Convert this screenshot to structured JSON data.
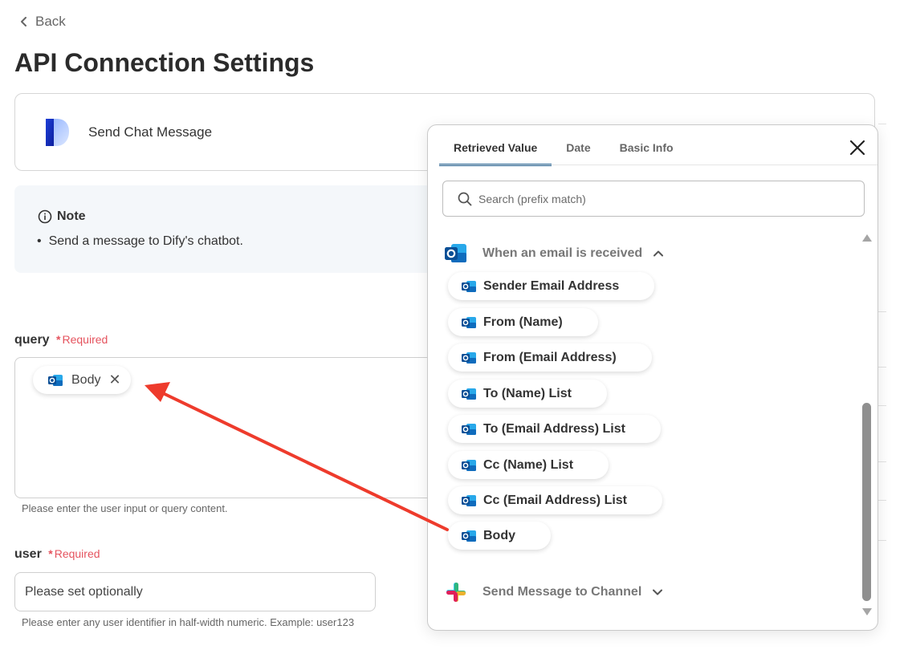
{
  "nav": {
    "back_label": "Back"
  },
  "page": {
    "title": "API Connection Settings"
  },
  "app_card": {
    "name": "Send Chat Message"
  },
  "note": {
    "title": "Note",
    "text": "Send a message to Dify's chatbot."
  },
  "fields": {
    "query": {
      "label": "query",
      "required_label": "Required",
      "chip_label": "Body",
      "help": "Please enter the user input or query content."
    },
    "user": {
      "label": "user",
      "required_label": "Required",
      "placeholder": "Please set optionally",
      "help": "Please enter any user identifier in half-width numeric. Example: user123"
    }
  },
  "popup": {
    "tabs": [
      {
        "label": "Retrieved Value",
        "active": true
      },
      {
        "label": "Date",
        "active": false
      },
      {
        "label": "Basic Info",
        "active": false
      }
    ],
    "search_placeholder": "Search (prefix match)",
    "groups": [
      {
        "label": "When an email is received",
        "icon": "outlook-icon",
        "expanded": true,
        "items": [
          "Sender Email Address",
          "From (Name)",
          "From (Email Address)",
          "To (Name) List",
          "To (Email Address) List",
          "Cc (Name) List",
          "Cc (Email Address) List",
          "Body"
        ]
      },
      {
        "label": "Send Message to Channel",
        "icon": "slack-icon",
        "expanded": false
      }
    ]
  },
  "colors": {
    "required": "#e5535e",
    "active_tab_underline": "#1e5f91",
    "annotation_arrow": "#ee3b2c",
    "outlook_blue": "#0f6cbd"
  }
}
